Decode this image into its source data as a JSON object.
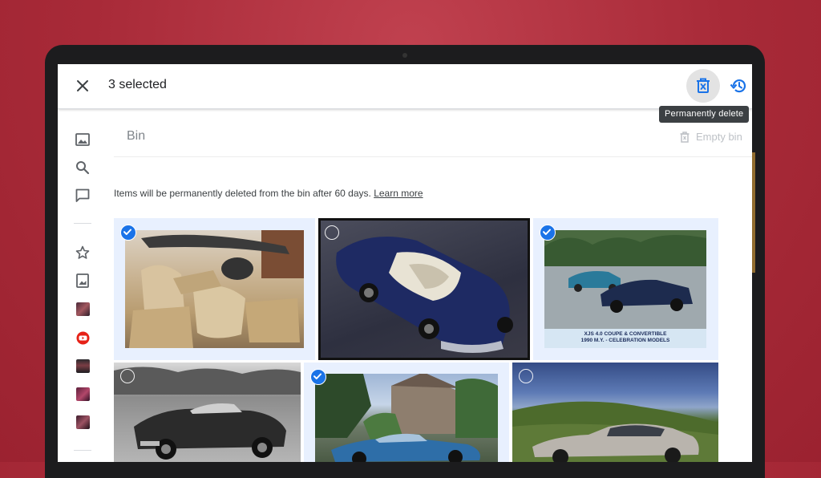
{
  "header": {
    "selected_label": "3 selected",
    "close_icon": "close-icon",
    "delete_icon": "delete-forever-icon",
    "restore_icon": "restore-history-icon"
  },
  "tooltip": {
    "text": "Permanently delete"
  },
  "sidebar": {
    "items": [
      {
        "icon": "photos-icon"
      },
      {
        "icon": "search-icon"
      },
      {
        "icon": "sharing-icon"
      },
      {
        "icon": "favourites-star-icon"
      },
      {
        "icon": "albums-icon"
      },
      {
        "icon": "album-thumbnail-1"
      },
      {
        "icon": "youtube-icon"
      },
      {
        "icon": "album-thumbnail-2"
      },
      {
        "icon": "album-thumbnail-3"
      },
      {
        "icon": "album-thumbnail-4"
      }
    ]
  },
  "page": {
    "title": "Bin",
    "empty_bin_label": "Empty bin",
    "info_text": "Items will be permanently deleted from the bin after 60 days.",
    "learn_more": "Learn more"
  },
  "photos": [
    {
      "description": "beige car interior",
      "selected": true
    },
    {
      "description": "blue convertible",
      "selected": false
    },
    {
      "description": "coupe and convertible brochure",
      "selected": true,
      "caption_line1": "XJS 4.0 COUPE & CONVERTIBLE",
      "caption_line2": "1990 M.Y. - CELEBRATION MODELS"
    },
    {
      "description": "black and white convertible",
      "selected": false
    },
    {
      "description": "blue coupe at house",
      "selected": true
    },
    {
      "description": "silver coupe on hill",
      "selected": false
    }
  ],
  "colors": {
    "accent": "#1a73e8",
    "selected_bg": "#e8f0fe",
    "background": "#a82a38"
  }
}
